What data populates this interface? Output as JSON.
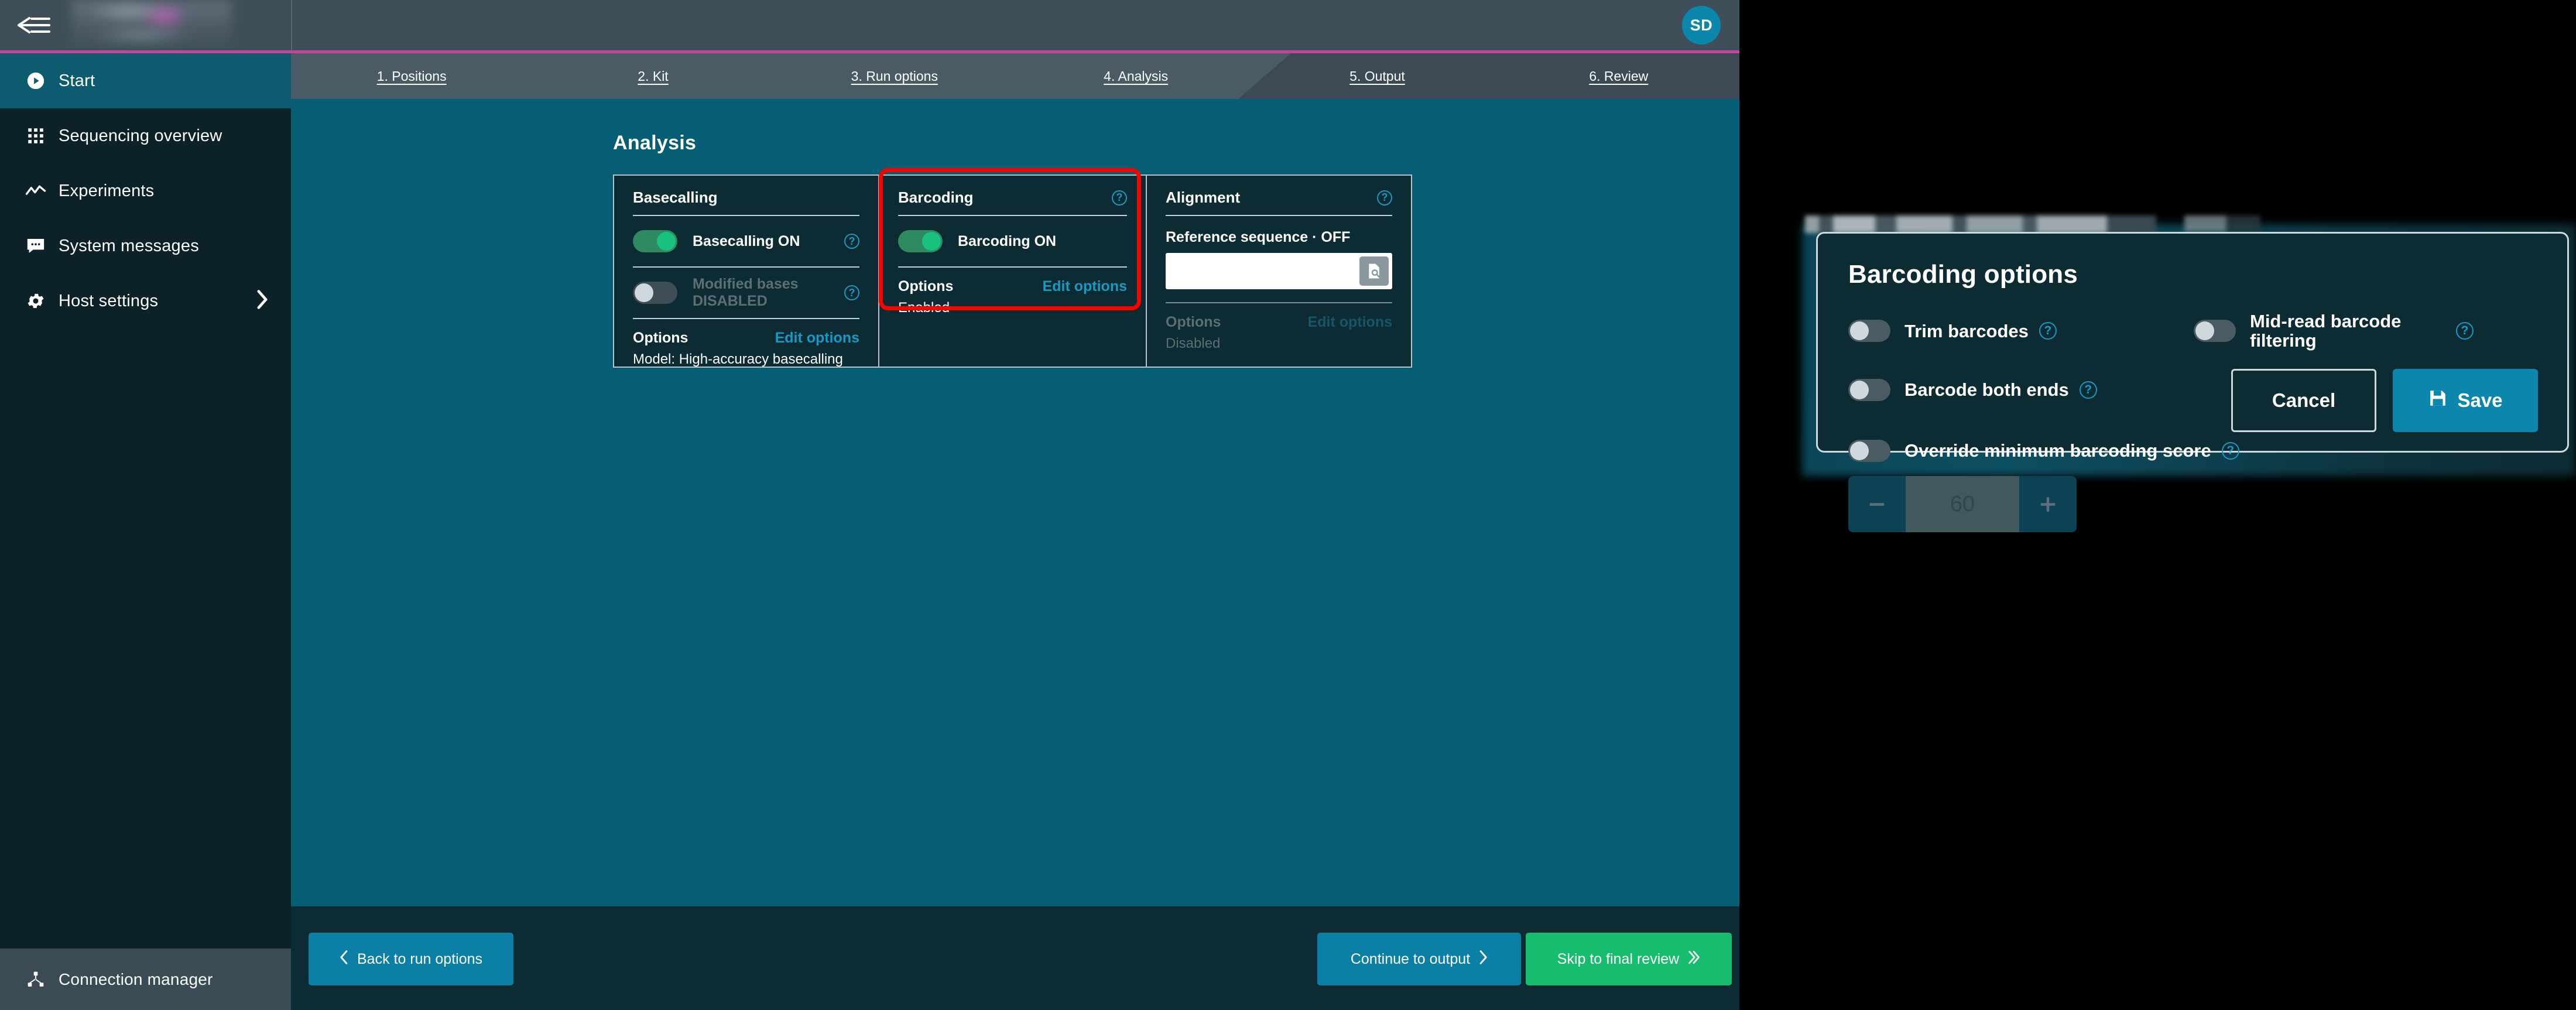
{
  "topbar": {
    "menu_icon": "back-arrow-menu-icon",
    "logo_alt": "redacted-logo",
    "avatar_initials": "SD"
  },
  "sidebar": {
    "items": [
      {
        "label": "Start",
        "icon": "play-circle-icon",
        "active": true,
        "has_chevron": false
      },
      {
        "label": "Sequencing overview",
        "icon": "grid-icon",
        "active": false,
        "has_chevron": false
      },
      {
        "label": "Experiments",
        "icon": "line-chart-icon",
        "active": false,
        "has_chevron": false
      },
      {
        "label": "System messages",
        "icon": "chat-bubble-icon",
        "active": false,
        "has_chevron": false
      },
      {
        "label": "Host settings",
        "icon": "gear-icon",
        "active": false,
        "has_chevron": true
      }
    ],
    "footer": {
      "label": "Connection manager",
      "icon": "network-node-icon"
    }
  },
  "steps": [
    {
      "label": "1. Positions",
      "active": false
    },
    {
      "label": "2. Kit",
      "active": false
    },
    {
      "label": "3. Run options",
      "active": false
    },
    {
      "label": "4. Analysis",
      "active": true
    },
    {
      "label": "5. Output",
      "active": false
    },
    {
      "label": "6. Review",
      "active": false
    }
  ],
  "main": {
    "page_title": "Analysis",
    "cards": [
      {
        "title": "Basecalling",
        "has_help": false,
        "toggles": [
          {
            "label": "Basecalling ON",
            "on": true,
            "dim": false,
            "help": true
          },
          {
            "label": "Modified bases DISABLED",
            "on": false,
            "dim": true,
            "help": true
          }
        ],
        "options_label": "Options",
        "edit_label": "Edit options",
        "options_value": "Model: High-accuracy basecalling",
        "dim": false
      },
      {
        "title": "Barcoding",
        "has_help": true,
        "toggles": [
          {
            "label": "Barcoding ON",
            "on": true,
            "dim": false,
            "help": false
          }
        ],
        "options_label": "Options",
        "edit_label": "Edit options",
        "options_value": "Enabled",
        "dim": false,
        "highlighted": true
      },
      {
        "title": "Alignment",
        "has_help": true,
        "reference_label": "Reference sequence · OFF",
        "reference_value": "",
        "reference_placeholder": "",
        "browse_icon": "file-search-icon",
        "options_label": "Options",
        "edit_label": "Edit options",
        "options_value": "Disabled",
        "dim": true
      }
    ]
  },
  "footer_buttons": {
    "back": "Back to run options",
    "continue": "Continue to output",
    "skip": "Skip to final review"
  },
  "modal": {
    "title": "Barcoding options",
    "toggles": [
      {
        "label": "Trim barcodes",
        "on": false,
        "help": true
      },
      {
        "label": "Mid-read barcode filtering",
        "on": false,
        "help": true
      },
      {
        "label": "Barcode both ends",
        "on": false,
        "help": true
      },
      {
        "label": "Override minimum barcoding score",
        "on": false,
        "help": true
      }
    ],
    "stepper": {
      "decrement_icon": "minus-icon",
      "value": "60",
      "increment_icon": "plus-icon"
    },
    "cancel_label": "Cancel",
    "save_label": "Save",
    "save_icon": "floppy-disk-icon"
  },
  "colors": {
    "accent_blue": "#0b86ad",
    "accent_green": "#17bd6e",
    "toggle_on": "#18c27e",
    "magenta_rule": "#c4449c",
    "highlight_red": "#ff0000",
    "content_bg": "#065e75",
    "panel_bg": "#0d2b33",
    "sidebar_bg": "#0d2228",
    "link_blue": "#1899c4"
  }
}
